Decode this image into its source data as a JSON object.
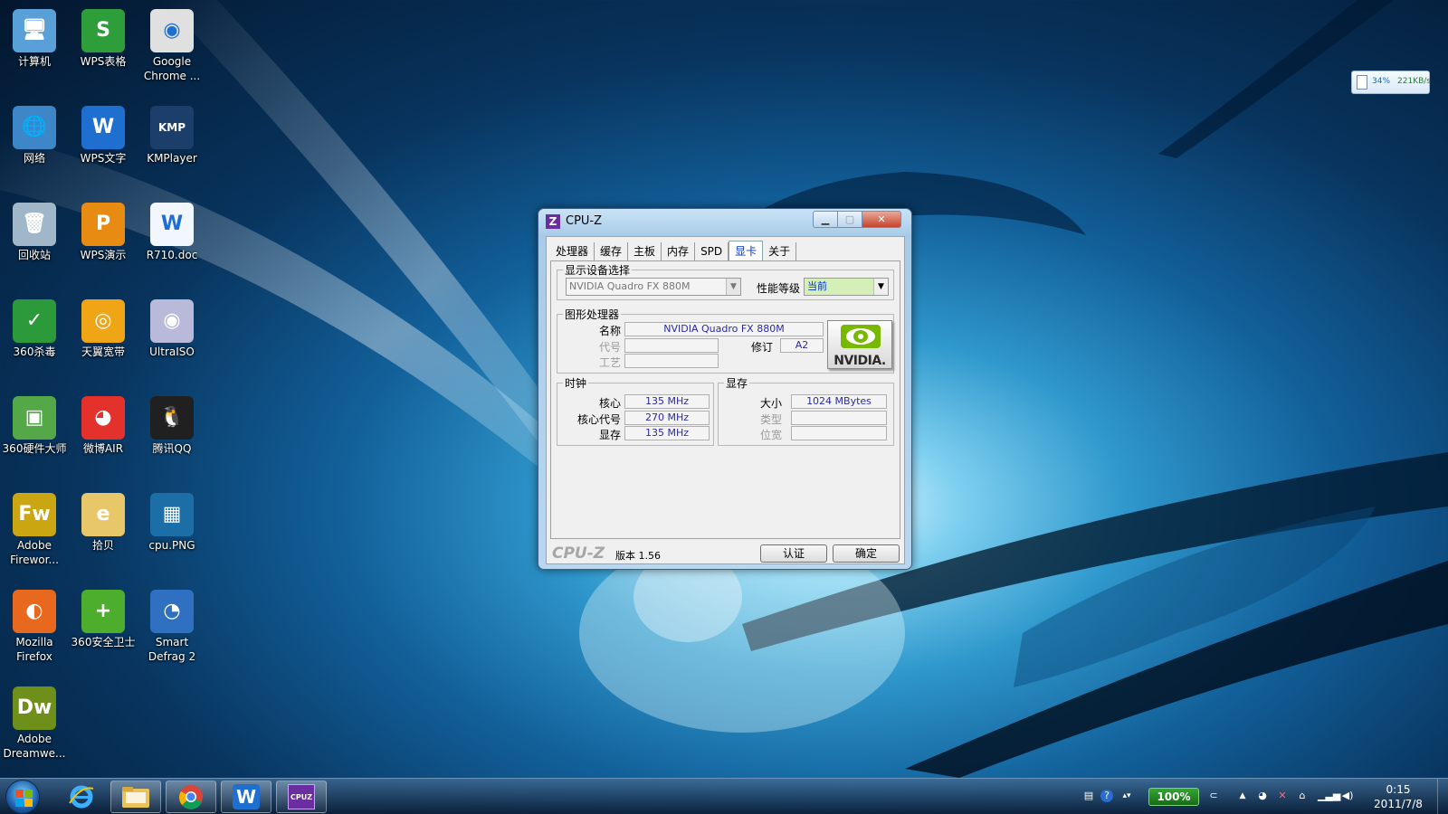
{
  "desktop": {
    "icons": [
      {
        "label": "计算机",
        "icon": "computer-icon",
        "glyph": "🖥",
        "bg": "#5aa0d8"
      },
      {
        "label": "WPS表格",
        "icon": "wps-spreadsheet-icon",
        "glyph": "S",
        "bg": "#2e9e3a"
      },
      {
        "label": "Google Chrome ...",
        "icon": "chrome-icon",
        "glyph": "◉",
        "bg": "#e0e0e0"
      },
      {
        "label": "网络",
        "icon": "network-icon",
        "glyph": "🌐",
        "bg": "#3d86c8"
      },
      {
        "label": "WPS文字",
        "icon": "wps-writer-icon",
        "glyph": "W",
        "bg": "#1f6fd0"
      },
      {
        "label": "KMPlayer",
        "icon": "kmplayer-icon",
        "glyph": "KMP",
        "bg": "#1b3f6a"
      },
      {
        "label": "回收站",
        "icon": "recycle-bin-icon",
        "glyph": "🗑",
        "bg": "#9fb7c9"
      },
      {
        "label": "WPS演示",
        "icon": "wps-presentation-icon",
        "glyph": "P",
        "bg": "#e88b12"
      },
      {
        "label": "R710.doc",
        "icon": "word-document-icon",
        "glyph": "W",
        "bg": "#f2f6ff"
      },
      {
        "label": "360杀毒",
        "icon": "antivirus-360-icon",
        "glyph": "✓",
        "bg": "#2c9a3a"
      },
      {
        "label": "天翼宽带",
        "icon": "tianyi-broadband-icon",
        "glyph": "◎",
        "bg": "#f0a516"
      },
      {
        "label": "UltraISO",
        "icon": "ultraiso-disc-icon",
        "glyph": "◉",
        "bg": "#b9b9d9"
      },
      {
        "label": "360硬件大师",
        "icon": "hardware-master-icon",
        "glyph": "▣",
        "bg": "#55a847"
      },
      {
        "label": "微博AIR",
        "icon": "weibo-icon",
        "glyph": "◕",
        "bg": "#e4312b"
      },
      {
        "label": "腾讯QQ",
        "icon": "qq-penguin-icon",
        "glyph": "🐧",
        "bg": "#202020"
      },
      {
        "label": "Adobe Firewor...",
        "icon": "adobe-fireworks-icon",
        "glyph": "Fw",
        "bg": "#c9a612"
      },
      {
        "label": "拾贝",
        "icon": "shibei-folder-icon",
        "glyph": "e",
        "bg": "#e8c66a"
      },
      {
        "label": "cpu.PNG",
        "icon": "image-file-icon",
        "glyph": "▦",
        "bg": "#1c6fa6"
      },
      {
        "label": "Mozilla Firefox",
        "icon": "firefox-icon",
        "glyph": "◐",
        "bg": "#e8681e"
      },
      {
        "label": "360安全卫士",
        "icon": "security-guard-360-icon",
        "glyph": "+",
        "bg": "#4cae2c"
      },
      {
        "label": "Smart Defrag 2",
        "icon": "smart-defrag-icon",
        "glyph": "◔",
        "bg": "#3070c0"
      },
      {
        "label": "Adobe Dreamwe...",
        "icon": "adobe-dreamweaver-icon",
        "glyph": "Dw",
        "bg": "#6e8f1a"
      }
    ]
  },
  "net_meter": {
    "percent": "34%",
    "speed": "221KB/s"
  },
  "window": {
    "title": "CPU-Z",
    "logo": "Z",
    "tabs": [
      {
        "label": "处理器",
        "selected": false
      },
      {
        "label": "缓存",
        "selected": false
      },
      {
        "label": "主板",
        "selected": false
      },
      {
        "label": "内存",
        "selected": false
      },
      {
        "label": "SPD",
        "selected": false
      },
      {
        "label": "显卡",
        "selected": true
      },
      {
        "label": "关于",
        "selected": false
      }
    ],
    "device_group": {
      "title": "显示设备选择",
      "device": "NVIDIA Quadro FX 880M",
      "perf_label": "性能等级",
      "perf_value": "当前"
    },
    "gpu_group": {
      "title": "图形处理器",
      "name_label": "名称",
      "name_value": "NVIDIA Quadro FX 880M",
      "code_label": "代号",
      "code_value": "",
      "revision_label": "修订",
      "revision_value": "A2",
      "tech_label": "工艺",
      "tech_value": "",
      "logo_text": "NVIDIA."
    },
    "clocks_group": {
      "title": "时钟",
      "core_label": "核心",
      "core_value": "135 MHz",
      "shader_label": "核心代号",
      "shader_value": "270 MHz",
      "memory_label": "显存",
      "memory_value": "135 MHz"
    },
    "memory_group": {
      "title": "显存",
      "size_label": "大小",
      "size_value": "1024 MBytes",
      "type_label": "类型",
      "type_value": "",
      "width_label": "位宽",
      "width_value": ""
    },
    "footer": {
      "brand": "CPU-Z",
      "version": "版本 1.56",
      "validate_label": "认证",
      "ok_label": "确定"
    }
  },
  "taskbar": {
    "pinned": [
      {
        "icon": "ie-icon"
      },
      {
        "icon": "explorer-folder-icon"
      },
      {
        "icon": "chrome-icon"
      },
      {
        "icon": "wps-writer-icon",
        "glyph": "W"
      },
      {
        "icon": "cpuz-icon",
        "glyph": "CPUZ"
      }
    ],
    "battery": "100%",
    "time": "0:15",
    "date": "2011/7/8"
  },
  "colors": {
    "accent": "#0033cc",
    "value_text": "#2a2aa8",
    "nvidia_green": "#76b900"
  }
}
